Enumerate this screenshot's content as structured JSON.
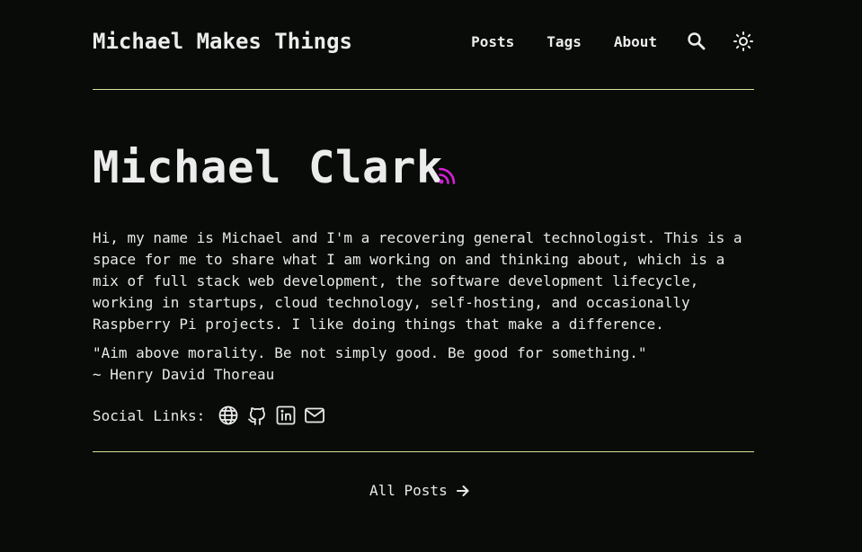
{
  "header": {
    "site_title": "Michael Makes Things",
    "nav": {
      "posts": "Posts",
      "tags": "Tags",
      "about": "About"
    },
    "icons": [
      "search-icon",
      "sun-icon"
    ]
  },
  "hero": {
    "name": "Michael Clark",
    "rss_icon": "rss-icon",
    "rss_color": "#d81fd8"
  },
  "bio": {
    "text": "Hi, my name is Michael and I'm a recovering general technologist. This is a space for me to share what I am working on and thinking about, which is a mix of full stack web development, the software development lifecycle, working in startups, cloud technology, self-hosting, and occasionally Raspberry Pi projects. I like doing things that make a difference.",
    "quote": "\"Aim above morality. Be not simply good. Be good for something.\"",
    "quote_author": "~ Henry David Thoreau"
  },
  "social": {
    "label": "Social Links:",
    "icons": [
      "globe-icon",
      "github-icon",
      "linkedin-icon",
      "mail-icon"
    ]
  },
  "footer_link": {
    "label": "All Posts",
    "icon": "arrow-right-icon"
  },
  "colors": {
    "background": "#080b08",
    "text": "#e8e8e8",
    "accent_line": "#d7e39a",
    "rss": "#d81fd8"
  }
}
